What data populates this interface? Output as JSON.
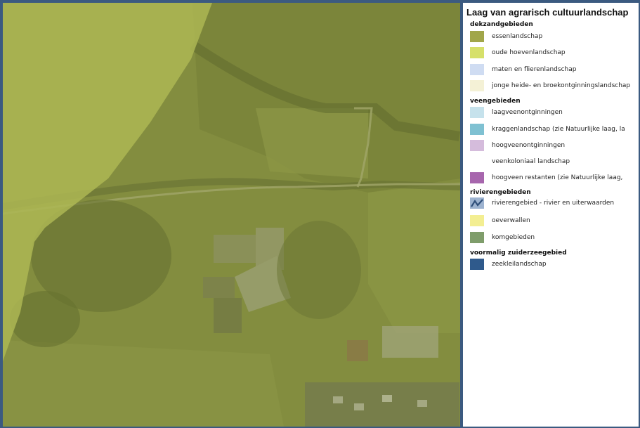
{
  "legend": {
    "title": "Laag van agrarisch cultuurlandschap",
    "groups": [
      {
        "name": "dekzandgebieden",
        "items": [
          {
            "label": "essenlandschap",
            "color": "#a1a64a"
          },
          {
            "label": "oude hoevenlandschap",
            "color": "#d6e06a"
          },
          {
            "label": "maten en flierenlandschap",
            "color": "#cfdcf2"
          },
          {
            "label": "jonge heide- en broekontginningslandschap",
            "color": "#f4f1d6"
          }
        ]
      },
      {
        "name": "veengebieden",
        "items": [
          {
            "label": "laagveenontginningen",
            "color": "#c6e2ec"
          },
          {
            "label": "kraggenlandschap (zie Natuurlijke laag, la",
            "color": "#7fc1d2"
          },
          {
            "label": "hoogveenontginningen",
            "color": "#d5bcdc"
          },
          {
            "label": "veenkoloniaal landschap",
            "color": "#ffffff"
          },
          {
            "label": "hoogveen restanten (zie Natuurlijke laag,",
            "color": "#a766ad"
          }
        ]
      },
      {
        "name": "rivierengebieden",
        "items": [
          {
            "label": "rivierengebied - rivier en uiterwaarden",
            "color": "#9db3d0",
            "icon": "river-line-icon"
          },
          {
            "label": "oeverwallen",
            "color": "#f3ee92"
          },
          {
            "label": "komgebieden",
            "color": "#7f9d6b"
          }
        ]
      },
      {
        "name": "voormalig zuiderzeegebied",
        "items": [
          {
            "label": "zeekleilandschap",
            "color": "#2f5a8c"
          }
        ]
      }
    ]
  },
  "map": {
    "overlay_dark_color": "#8a9341",
    "overlay_light_color": "#b8c35a"
  }
}
